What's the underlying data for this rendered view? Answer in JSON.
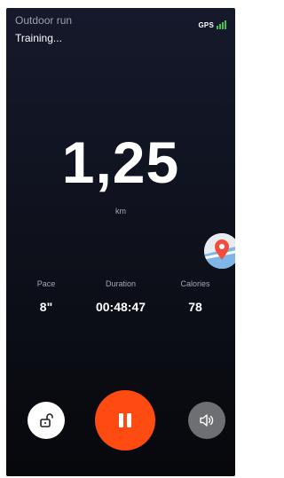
{
  "header": {
    "title": "Outdoor run",
    "status": "Training...",
    "gps_label": "GPS",
    "gps_color": "#41c24f"
  },
  "distance": {
    "value": "1,25",
    "unit": "km"
  },
  "stats": [
    {
      "label": "Pace",
      "value": "8\""
    },
    {
      "label": "Duration",
      "value": "00:48:47"
    },
    {
      "label": "Calories",
      "value": "78"
    }
  ],
  "controls": {
    "lock_icon": "unlock-icon",
    "pause_icon": "pause-icon",
    "sound_icon": "speaker-icon",
    "map_icon": "map-pin-icon",
    "pause_color": "#fe4b11"
  }
}
